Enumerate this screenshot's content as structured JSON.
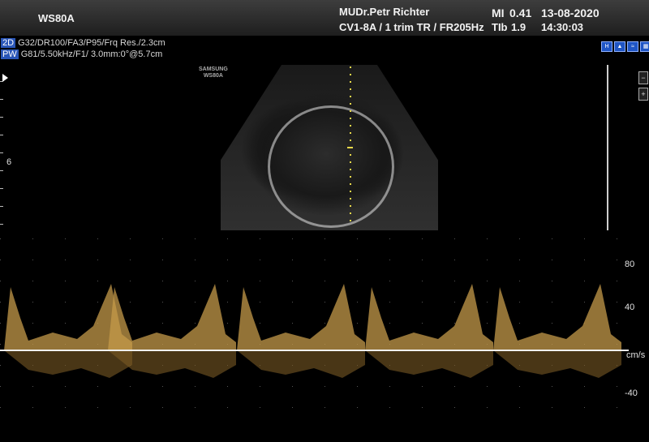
{
  "header": {
    "model": "WS80A",
    "physician": "MUDr.Petr Richter",
    "protocol": "CV1-8A / 1 trim TR / FR205Hz",
    "mi_label": "MI",
    "mi_value": "0.41",
    "tib_label": "TIb",
    "tib_value": "1.9",
    "date": "13-08-2020",
    "time": "14:30:03"
  },
  "params": {
    "mode_2d": "2D",
    "line_2d": "G32/DR100/FA3/P95/Frq Res./2.3cm",
    "mode_pw": "PW",
    "line_pw": "G81/5.50kHz/F1/ 3.0mm:0°@5.7cm"
  },
  "image": {
    "watermark_line1": "SAMSUNG",
    "watermark_line2": "WS80A",
    "depth_label": "6"
  },
  "doppler": {
    "unit": "cm/s",
    "scale_labels": [
      "80",
      "40",
      "-40"
    ],
    "scale_values": [
      80,
      40,
      -40
    ],
    "peaks_beats": 5
  },
  "icons": [
    "har-icon",
    "probe-icon",
    "chart-icon",
    "grid-icon"
  ],
  "colors": {
    "doppler_signal": "#c49a4a",
    "highlight_blue": "#2a56b8",
    "cursor_yellow": "#e8d84a"
  }
}
